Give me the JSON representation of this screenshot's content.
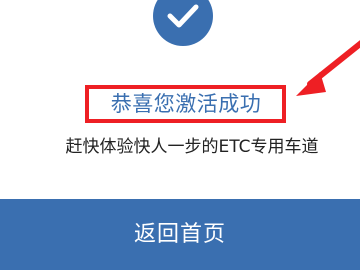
{
  "success": {
    "icon": "check-icon",
    "accent_color": "#3a6fb0"
  },
  "message": {
    "title": "恭喜您激活成功",
    "subtitle": "赶快体验快人一步的ETC专用车道"
  },
  "annotation": {
    "highlight_color": "#ee1f24",
    "icon": "arrow-pointer-icon"
  },
  "actions": {
    "return_home_label": "返回首页"
  }
}
